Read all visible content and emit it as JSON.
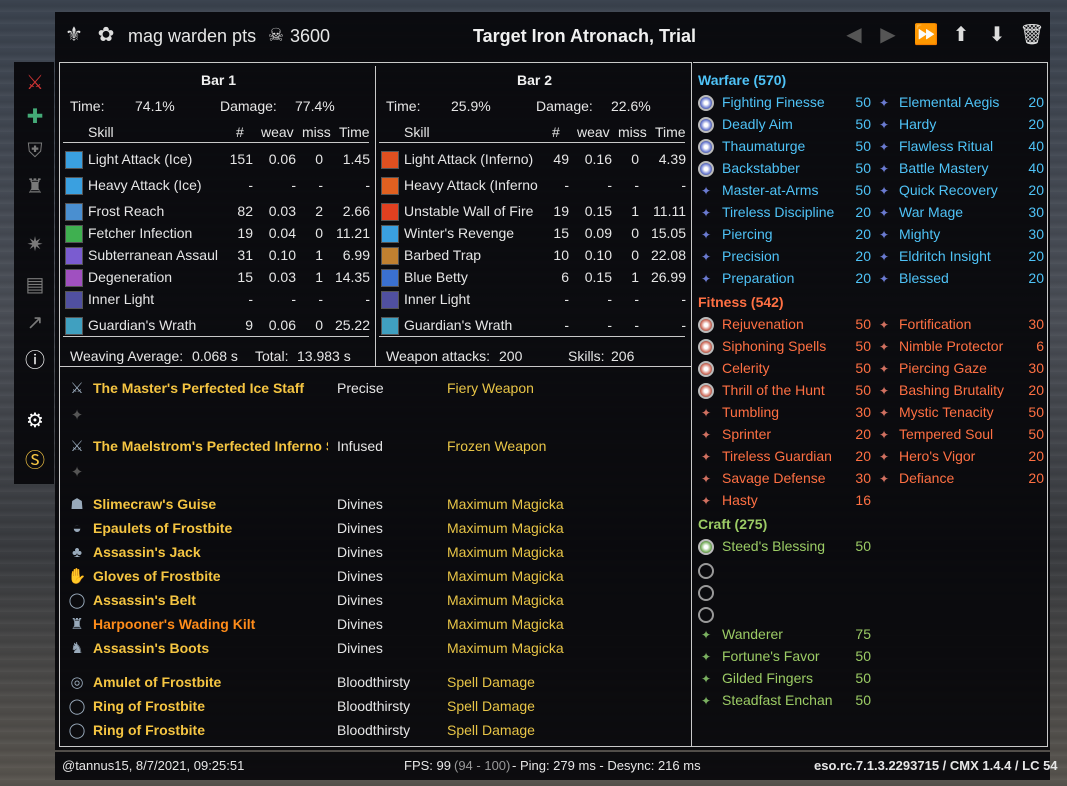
{
  "header": {
    "profile": "mag warden pts",
    "points": "3600",
    "target": "Target Iron Atronach, Trial"
  },
  "bar1": {
    "title": "Bar 1",
    "time_label": "Time:",
    "time_value": "74.1%",
    "damage_label": "Damage:",
    "damage_value": "77.4%",
    "cols": [
      "Skill",
      "#",
      "weav",
      "miss",
      "Time"
    ],
    "rows": [
      [
        "Light Attack (Ice)",
        "151",
        "0.06",
        "0",
        "1.45"
      ],
      [
        "Heavy Attack (Ice)",
        "-",
        "-",
        "-",
        "-"
      ],
      [
        "Frost Reach",
        "82",
        "0.03",
        "2",
        "2.66"
      ],
      [
        "Fetcher Infection",
        "19",
        "0.04",
        "0",
        "11.21"
      ],
      [
        "Subterranean Assaul",
        "31",
        "0.10",
        "1",
        "6.99"
      ],
      [
        "Degeneration",
        "15",
        "0.03",
        "1",
        "14.35"
      ],
      [
        "Inner Light",
        "-",
        "-",
        "-",
        "-"
      ],
      [
        "Guardian's Wrath",
        "9",
        "0.06",
        "0",
        "25.22"
      ]
    ],
    "footer_label": "Weaving Average:",
    "footer_value": "0.068 s",
    "total_label": "Total:",
    "total_value": "13.983 s"
  },
  "bar2": {
    "title": "Bar 2",
    "time_label": "Time:",
    "time_value": "25.9%",
    "damage_label": "Damage:",
    "damage_value": "22.6%",
    "cols": [
      "Skill",
      "#",
      "weav",
      "miss",
      "Time"
    ],
    "rows": [
      [
        "Light Attack (Inferno)",
        "49",
        "0.16",
        "0",
        "4.39"
      ],
      [
        "Heavy Attack (Inferno",
        "-",
        "-",
        "-",
        "-"
      ],
      [
        "Unstable Wall of Fire",
        "19",
        "0.15",
        "1",
        "11.11"
      ],
      [
        "Winter's Revenge",
        "15",
        "0.09",
        "0",
        "15.05"
      ],
      [
        "Barbed Trap",
        "10",
        "0.10",
        "0",
        "22.08"
      ],
      [
        "Blue Betty",
        "6",
        "0.15",
        "1",
        "26.99"
      ],
      [
        "Inner Light",
        "-",
        "-",
        "-",
        "-"
      ],
      [
        "Guardian's Wrath",
        "-",
        "-",
        "-",
        "-"
      ]
    ],
    "weapon_label": "Weapon attacks:",
    "weapon_value": "200",
    "skills_label": "Skills:",
    "skills_value": "206"
  },
  "gear": [
    {
      "name": "The Master's Perfected Ice Staff",
      "trait": "Precise",
      "enchant": "Fiery Weapon",
      "color": "gold"
    },
    {
      "name": "The Maelstrom's Perfected Inferno St",
      "trait": "Infused",
      "enchant": "Frozen Weapon",
      "color": "gold"
    },
    {
      "name": "Slimecraw's Guise",
      "trait": "Divines",
      "enchant": "Maximum Magicka",
      "color": "gold"
    },
    {
      "name": "Epaulets of Frostbite",
      "trait": "Divines",
      "enchant": "Maximum Magicka",
      "color": "gold"
    },
    {
      "name": "Assassin's Jack",
      "trait": "Divines",
      "enchant": "Maximum Magicka",
      "color": "gold"
    },
    {
      "name": "Gloves of Frostbite",
      "trait": "Divines",
      "enchant": "Maximum Magicka",
      "color": "gold"
    },
    {
      "name": "Assassin's Belt",
      "trait": "Divines",
      "enchant": "Maximum Magicka",
      "color": "gold"
    },
    {
      "name": "Harpooner's Wading Kilt",
      "trait": "Divines",
      "enchant": "Maximum Magicka",
      "color": "orange"
    },
    {
      "name": "Assassin's Boots",
      "trait": "Divines",
      "enchant": "Maximum Magicka",
      "color": "gold"
    },
    {
      "name": "Amulet of Frostbite",
      "trait": "Bloodthirsty",
      "enchant": "Spell Damage",
      "color": "gold"
    },
    {
      "name": "Ring of Frostbite",
      "trait": "Bloodthirsty",
      "enchant": "Spell Damage",
      "color": "gold"
    },
    {
      "name": "Ring of Frostbite",
      "trait": "Bloodthirsty",
      "enchant": "Spell Damage",
      "color": "gold"
    }
  ],
  "cp": {
    "warfare_title": "Warfare (570)",
    "warfare_left": [
      [
        "Fighting Finesse",
        "50"
      ],
      [
        "Deadly Aim",
        "50"
      ],
      [
        "Thaumaturge",
        "50"
      ],
      [
        "Backstabber",
        "50"
      ],
      [
        "Master-at-Arms",
        "50"
      ],
      [
        "Tireless Discipline",
        "20"
      ],
      [
        "Piercing",
        "20"
      ],
      [
        "Precision",
        "20"
      ],
      [
        "Preparation",
        "20"
      ]
    ],
    "warfare_right": [
      [
        "Elemental Aegis",
        "20"
      ],
      [
        "Hardy",
        "20"
      ],
      [
        "Flawless Ritual",
        "40"
      ],
      [
        "Battle Mastery",
        "40"
      ],
      [
        "Quick Recovery",
        "20"
      ],
      [
        "War Mage",
        "30"
      ],
      [
        "Mighty",
        "30"
      ],
      [
        "Eldritch Insight",
        "20"
      ],
      [
        "Blessed",
        "20"
      ]
    ],
    "fitness_title": "Fitness (542)",
    "fitness_left": [
      [
        "Rejuvenation",
        "50"
      ],
      [
        "Siphoning Spells",
        "50"
      ],
      [
        "Celerity",
        "50"
      ],
      [
        "Thrill of the Hunt",
        "50"
      ],
      [
        "Tumbling",
        "30"
      ],
      [
        "Sprinter",
        "20"
      ],
      [
        "Tireless Guardian",
        "20"
      ],
      [
        "Savage Defense",
        "30"
      ],
      [
        "Hasty",
        "16"
      ]
    ],
    "fitness_right": [
      [
        "Fortification",
        "30"
      ],
      [
        "Nimble Protector",
        "6"
      ],
      [
        "Piercing Gaze",
        "30"
      ],
      [
        "Bashing Brutality",
        "20"
      ],
      [
        "Mystic Tenacity",
        "50"
      ],
      [
        "Tempered Soul",
        "50"
      ],
      [
        "Hero's Vigor",
        "20"
      ],
      [
        "Defiance",
        "20"
      ]
    ],
    "craft_title": "Craft (275)",
    "craft_slotted": [
      [
        "Steed's Blessing",
        "50"
      ]
    ],
    "craft_other": [
      [
        "Wanderer",
        "75"
      ],
      [
        "Fortune's Favor",
        "50"
      ],
      [
        "Gilded Fingers",
        "50"
      ],
      [
        "Steadfast Enchan",
        "50"
      ]
    ]
  },
  "footer": {
    "user": "@tannus15, 8/7/2021, 09:25:51",
    "fps_label": "FPS: 99",
    "fps_range": "(94 - 100)",
    "ping": "- Ping: 279 ms - Desync: 216 ms",
    "version": "eso.rc.7.1.3.2293715 / CMX 1.4.4 / LC 54"
  },
  "colors": {
    "warfare": "#4fc3f7",
    "fitness": "#ff7043",
    "craft": "#9ccc65",
    "set": "#f5c542",
    "enchant": "#e8c547"
  }
}
